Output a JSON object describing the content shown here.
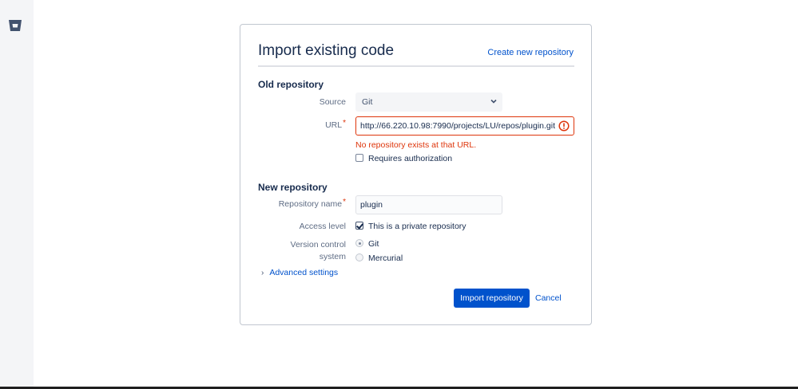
{
  "app": {
    "logo": "bitbucket-logo-icon"
  },
  "form": {
    "title": "Import existing code",
    "create_link": "Create new repository",
    "old_repo": {
      "heading": "Old repository",
      "source_label": "Source",
      "source_value": "Git",
      "url_label": "URL",
      "url_value": "http://66.220.10.98:7990/projects/LU/repos/plugin.git",
      "error": "No repository exists at that URL.",
      "requires_auth_label": "Requires authorization",
      "requires_auth_checked": false
    },
    "new_repo": {
      "heading": "New repository",
      "name_label": "Repository name",
      "name_value": "plugin",
      "access_label": "Access level",
      "private_label": "This is a private repository",
      "private_checked": true,
      "vcs_label_1": "Version control",
      "vcs_label_2": "system",
      "vcs_options": [
        "Git",
        "Mercurial"
      ],
      "vcs_selected": "Git"
    },
    "advanced_label": "Advanced settings",
    "import_button": "Import repository",
    "cancel_label": "Cancel"
  },
  "colors": {
    "brand": "#0052cc",
    "error": "#de350b",
    "sidebar": "#f4f5f7"
  }
}
